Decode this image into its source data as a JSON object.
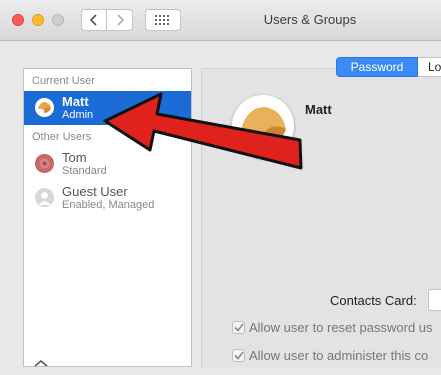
{
  "window": {
    "title": "Users & Groups"
  },
  "sidebar": {
    "current_user_label": "Current User",
    "other_users_label": "Other Users",
    "users": [
      {
        "name": "Matt",
        "role": "Admin",
        "selected": true
      },
      {
        "name": "Tom",
        "role": "Standard",
        "selected": false
      },
      {
        "name": "Guest User",
        "role": "Enabled, Managed",
        "selected": false
      }
    ]
  },
  "tabs": [
    {
      "label": "Password",
      "active": true
    },
    {
      "label": "Lo",
      "active": false
    }
  ],
  "main": {
    "user_name": "Matt",
    "contacts_card_label": "Contacts Card:",
    "checkboxes": [
      {
        "label": "Allow user to reset password us",
        "checked": true
      },
      {
        "label": "Allow user to administer this co",
        "checked": true
      }
    ]
  },
  "colors": {
    "selection": "#1b6bd6",
    "tab_active": "#3b8af5",
    "arrow": "#e0221e"
  }
}
